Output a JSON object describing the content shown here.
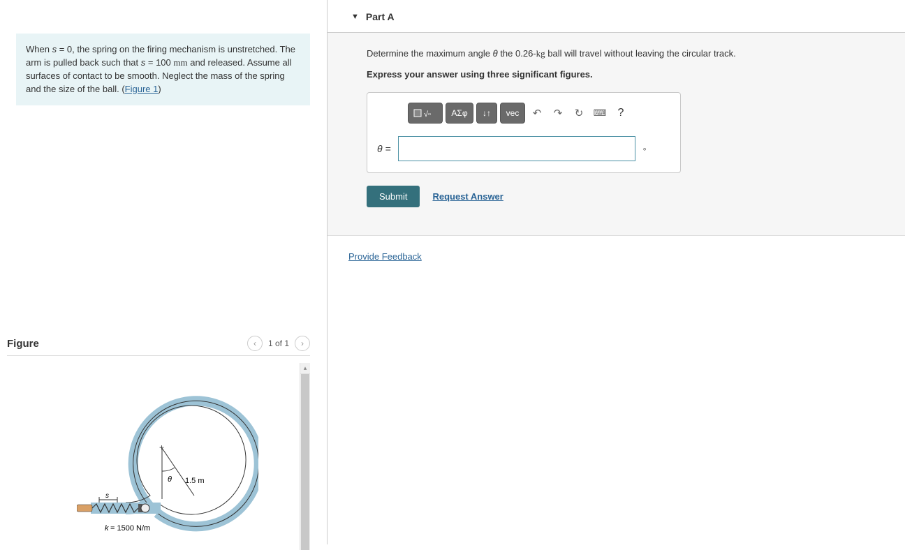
{
  "problem": {
    "text_pre": "When ",
    "var1": "s",
    "text_2": " = 0, the spring on the firing mechanism is unstretched. The arm is pulled back such that ",
    "var2": "s",
    "text_3": " = 100 ",
    "unit_mm": "mm",
    "text_4": " and released. Assume all surfaces of contact to be smooth. Neglect the mass of the spring and the size of the ball. (",
    "figure_link": "Figure 1",
    "text_end": ")"
  },
  "figure": {
    "title": "Figure",
    "nav_text": "1 of 1",
    "labels": {
      "s": "s",
      "theta": "θ",
      "radius": "1.5 m",
      "k": "k = 1500 N/m",
      "plus": "+"
    }
  },
  "part": {
    "title": "Part A",
    "question_pre": "Determine the maximum angle ",
    "question_var": "θ",
    "question_mid": " the 0.26-",
    "question_unit": "kg",
    "question_post": " ball will travel without leaving the circular track.",
    "instruction": "Express your answer using three significant figures.",
    "theta_eq": "θ =",
    "unit": "∘",
    "toolbar": {
      "templates_alt": "templates",
      "greek": "ΑΣφ",
      "subsup": "↓↑",
      "vec": "vec",
      "undo": "↶",
      "redo": "↷",
      "reset": "↻",
      "keyboard": "⌨",
      "help": "?"
    },
    "submit": "Submit",
    "request": "Request Answer"
  },
  "feedback": "Provide Feedback"
}
